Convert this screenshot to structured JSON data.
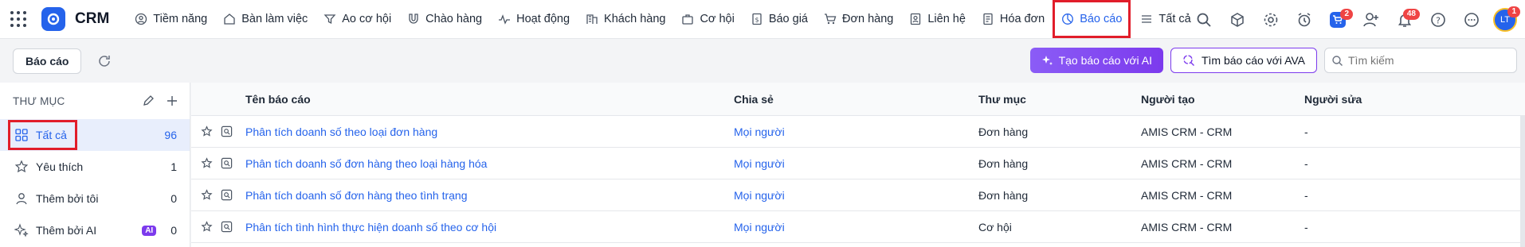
{
  "brand": "CRM",
  "nav": [
    {
      "label": "Tiềm năng",
      "icon": "leads-icon"
    },
    {
      "label": "Bàn làm việc",
      "icon": "workspace-icon"
    },
    {
      "label": "Ao cơ hội",
      "icon": "funnel-icon"
    },
    {
      "label": "Chào hàng",
      "icon": "magnet-icon"
    },
    {
      "label": "Hoạt động",
      "icon": "activity-icon"
    },
    {
      "label": "Khách hàng",
      "icon": "building-icon"
    },
    {
      "label": "Cơ hội",
      "icon": "briefcase-icon"
    },
    {
      "label": "Báo giá",
      "icon": "quote-icon"
    },
    {
      "label": "Đơn hàng",
      "icon": "cart-icon"
    },
    {
      "label": "Liên hệ",
      "icon": "contact-icon"
    },
    {
      "label": "Hóa đơn",
      "icon": "invoice-icon"
    },
    {
      "label": "Báo cáo",
      "icon": "report-icon",
      "active": true
    },
    {
      "label": "Tất cả",
      "icon": "menu-icon"
    }
  ],
  "badges": {
    "cart": "2",
    "notifications": "48",
    "avatar": "1"
  },
  "avatar_initials": "LT",
  "toolbar": {
    "tab_label": "Báo cáo",
    "ai_button": "Tạo báo cáo với AI",
    "ava_button": "Tìm báo cáo với AVA",
    "search_placeholder": "Tìm kiếm"
  },
  "sidebar": {
    "title": "THƯ MỤC",
    "items": [
      {
        "label": "Tất cả",
        "count": "96",
        "icon": "grid-icon"
      },
      {
        "label": "Yêu thích",
        "count": "1",
        "icon": "star-icon"
      },
      {
        "label": "Thêm bởi tôi",
        "count": "0",
        "icon": "user-icon"
      },
      {
        "label": "Thêm bởi AI",
        "count": "0",
        "icon": "sparkle-icon",
        "tag": "AI"
      }
    ]
  },
  "table": {
    "columns": [
      "Tên báo cáo",
      "Chia sẻ",
      "Thư mục",
      "Người tạo",
      "Người sửa"
    ],
    "rows": [
      {
        "name": "Phân tích doanh số theo loại đơn hàng",
        "share": "Mọi người",
        "folder": "Đơn hàng",
        "creator": "AMIS CRM - CRM",
        "editor": "-"
      },
      {
        "name": "Phân tích doanh số đơn hàng theo loại hàng hóa",
        "share": "Mọi người",
        "folder": "Đơn hàng",
        "creator": "AMIS CRM - CRM",
        "editor": "-"
      },
      {
        "name": "Phân tích doanh số đơn hàng theo tình trạng",
        "share": "Mọi người",
        "folder": "Đơn hàng",
        "creator": "AMIS CRM - CRM",
        "editor": "-"
      },
      {
        "name": "Phân tích tình hình thực hiện doanh số theo cơ hội",
        "share": "Mọi người",
        "folder": "Cơ hội",
        "creator": "AMIS CRM - CRM",
        "editor": "-"
      }
    ]
  },
  "colors": {
    "accent": "#2563eb",
    "highlight": "#e11d2a",
    "ai": "#7c3aed"
  }
}
